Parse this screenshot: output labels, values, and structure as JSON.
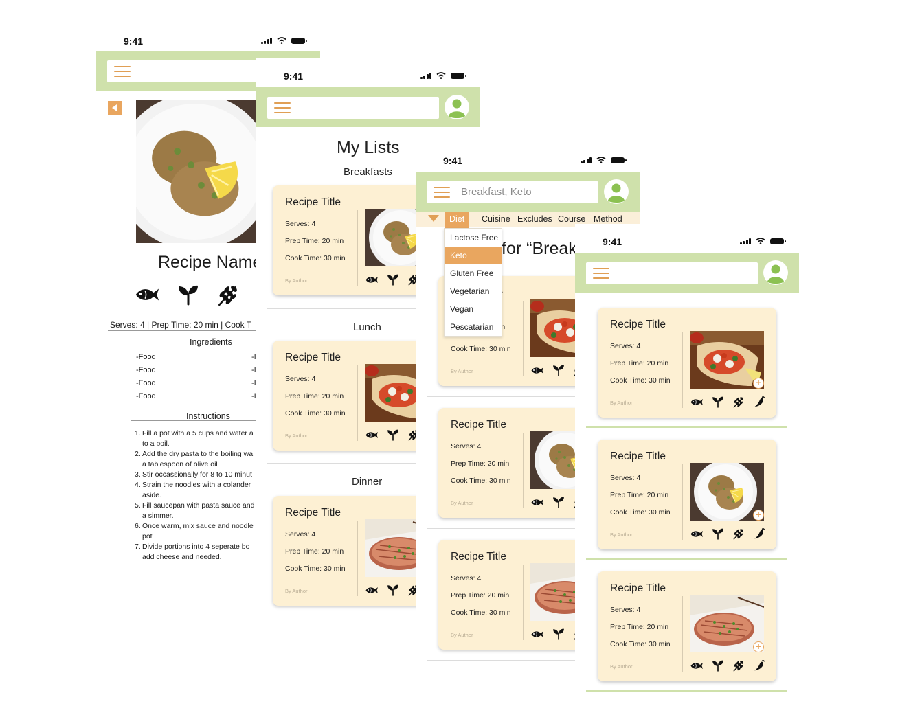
{
  "status_time": "9:41",
  "detail": {
    "recipe_name": "Recipe Name",
    "serves_line": "Serves: 4 |  Prep Time: 20 min |   Cook T",
    "ingredients_title": "Ingredients",
    "foods": [
      "-Food",
      "-Food",
      "-Food",
      "-Food"
    ],
    "foods_right": [
      "-I",
      "-I",
      "-I",
      "-I"
    ],
    "instructions_title": "Instructions",
    "steps": [
      {
        "n": "1.",
        "lines": [
          "Fill a pot with a 5 cups and water a",
          "to a boil."
        ]
      },
      {
        "n": "2.",
        "lines": [
          "Add the dry pasta to the boiling wa",
          "a tablespoon of olive oil"
        ]
      },
      {
        "n": "3.",
        "lines": [
          "Stir occassionally for 8 to 10 minut"
        ]
      },
      {
        "n": "4.",
        "lines": [
          "Strain the noodles with a colander",
          "aside."
        ]
      },
      {
        "n": "5.",
        "lines": [
          "Fill saucepan with pasta sauce and",
          "a simmer."
        ]
      },
      {
        "n": "6.",
        "lines": [
          "Once warm, mix sauce and noodle",
          "pot"
        ]
      },
      {
        "n": "7.",
        "lines": [
          "Divide portions into 4 seperate bo",
          "add cheese and needed."
        ]
      }
    ]
  },
  "lists": {
    "title": "My Lists",
    "sections": [
      "Breakfasts",
      "Lunch",
      "Dinner"
    ]
  },
  "card": {
    "title": "Recipe Title",
    "serves": "Serves: 4",
    "prep": "Prep Time: 20 min",
    "cook": "Cook Time: 30 min",
    "author": "By Author"
  },
  "search": {
    "query": "Breakfast, Keto",
    "tabs": [
      "Diet",
      "Cuisine",
      "Excludes",
      "Course",
      "Method"
    ],
    "diet_options": [
      "Lactose Free",
      "Keto",
      "Gluten Free",
      "Vegetarian",
      "Vegan",
      "Pescatarian"
    ],
    "selected_option": "Keto",
    "results_title_fragment": "for “Break",
    "hidden_card_fragments": [
      "e",
      "in",
      "Cook Time: 30 min"
    ]
  },
  "colors": {
    "appbar": "#cfe1ab",
    "accent_orange": "#e9a65f",
    "card_bg": "#fdf0d3",
    "avatar_green": "#8cc152"
  },
  "icons": [
    "menu-icon",
    "avatar-icon",
    "back-icon",
    "fish-icon",
    "sprout-icon",
    "wheat-icon",
    "chili-icon",
    "filter-icon",
    "add-icon"
  ]
}
